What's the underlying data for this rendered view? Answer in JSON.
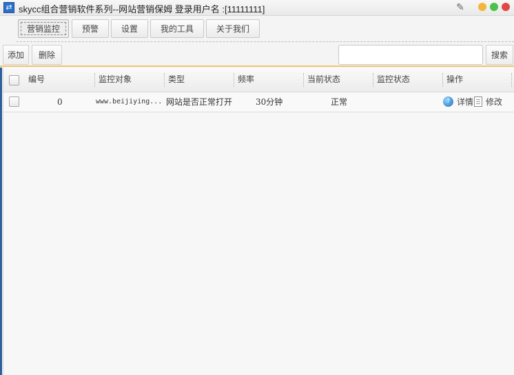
{
  "window": {
    "title": "skycc组合营销软件系列--网站营销保姆 登录用户名 :[11111111]",
    "icons": {
      "app": "app-swap-icon",
      "settings": "wrench-icon"
    },
    "controls": {
      "minimize": "#f3b53b",
      "maximize": "#4dc24a",
      "close": "#e04848"
    }
  },
  "tabs": [
    {
      "label": "营销监控",
      "active": true
    },
    {
      "label": "预警",
      "active": false
    },
    {
      "label": "设置",
      "active": false
    },
    {
      "label": "我的工具",
      "active": false
    },
    {
      "label": "关于我们",
      "active": false
    }
  ],
  "toolbar": {
    "add_label": "添加",
    "delete_label": "删除",
    "search_value": "",
    "search_label": "搜索",
    "accent_color": "#f0c36a"
  },
  "table": {
    "columns": [
      "编号",
      "监控对象",
      "类型",
      "频率",
      "当前状态",
      "监控状态",
      "操作"
    ],
    "rows": [
      {
        "id": "0",
        "target": "www.beijiying...",
        "type": "网站是否正常打开",
        "frequency": "30分钟",
        "current_status": "正常",
        "monitor_status": "",
        "actions": {
          "detail": "详情",
          "edit": "修改"
        }
      }
    ]
  }
}
